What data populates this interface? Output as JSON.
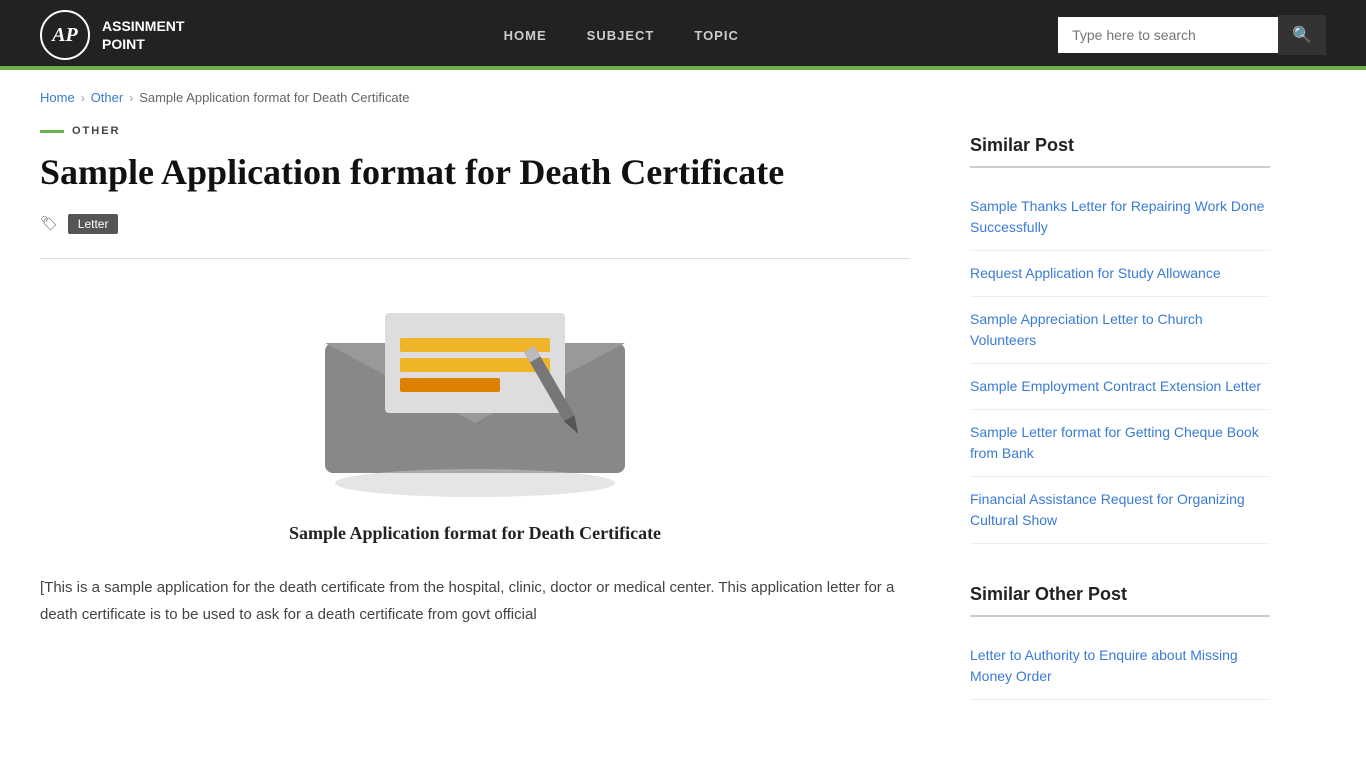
{
  "header": {
    "logo_initials": "AP",
    "logo_line1": "ASSINMENT",
    "logo_line2": "POINT",
    "nav": [
      {
        "label": "HOME",
        "href": "#"
      },
      {
        "label": "SUBJECT",
        "href": "#"
      },
      {
        "label": "TOPIC",
        "href": "#"
      }
    ],
    "search_placeholder": "Type here to search"
  },
  "breadcrumb": {
    "items": [
      {
        "label": "Home",
        "href": "#"
      },
      {
        "label": "Other",
        "href": "#"
      },
      {
        "label": "Sample Application format for Death Certificate",
        "href": "#"
      }
    ]
  },
  "article": {
    "category": "OTHER",
    "title": "Sample Application format for Death Certificate",
    "tag": "Letter",
    "image_caption": "Sample Application format for Death Certificate",
    "body": "[This is a sample application for the death certificate from the hospital, clinic, doctor or medical center. This application letter for a death certificate is to be used to ask for a death certificate from govt official"
  },
  "sidebar": {
    "similar_post_title": "Similar Post",
    "similar_posts": [
      {
        "label": "Sample Thanks Letter for Repairing Work Done Successfully",
        "href": "#"
      },
      {
        "label": "Request Application for Study Allowance",
        "href": "#"
      },
      {
        "label": "Sample Appreciation Letter to Church Volunteers",
        "href": "#"
      },
      {
        "label": "Sample Employment Contract Extension Letter",
        "href": "#"
      },
      {
        "label": "Sample Letter format for Getting Cheque Book from Bank",
        "href": "#"
      },
      {
        "label": "Financial Assistance Request for Organizing Cultural Show",
        "href": "#"
      }
    ],
    "similar_other_title": "Similar Other Post",
    "similar_other_posts": [
      {
        "label": "Letter to Authority to Enquire about Missing Money Order",
        "href": "#"
      }
    ]
  }
}
